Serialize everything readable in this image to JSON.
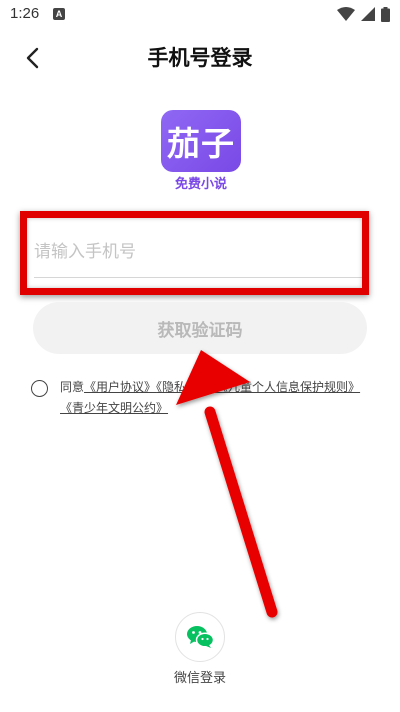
{
  "status_bar": {
    "time": "1:26",
    "notif_letter": "A"
  },
  "header": {
    "title": "手机号登录"
  },
  "logo": {
    "text": "茄子",
    "subtitle": "免费小说"
  },
  "phone_input": {
    "placeholder": "请输入手机号",
    "value": ""
  },
  "get_code_button": {
    "label": "获取验证码"
  },
  "agreement": {
    "prefix": "同意",
    "user_agreement": "《用户协议》",
    "privacy_policy": "《隐私政策》",
    "child_protection": "《儿童个人信息保护规则》",
    "youth_pact": "《青少年文明公约》",
    "checked": false
  },
  "wechat_login": {
    "label": "微信登录"
  },
  "colors": {
    "brand": "#7a49e6",
    "highlight": "#e00000",
    "wechat": "#07c160"
  }
}
